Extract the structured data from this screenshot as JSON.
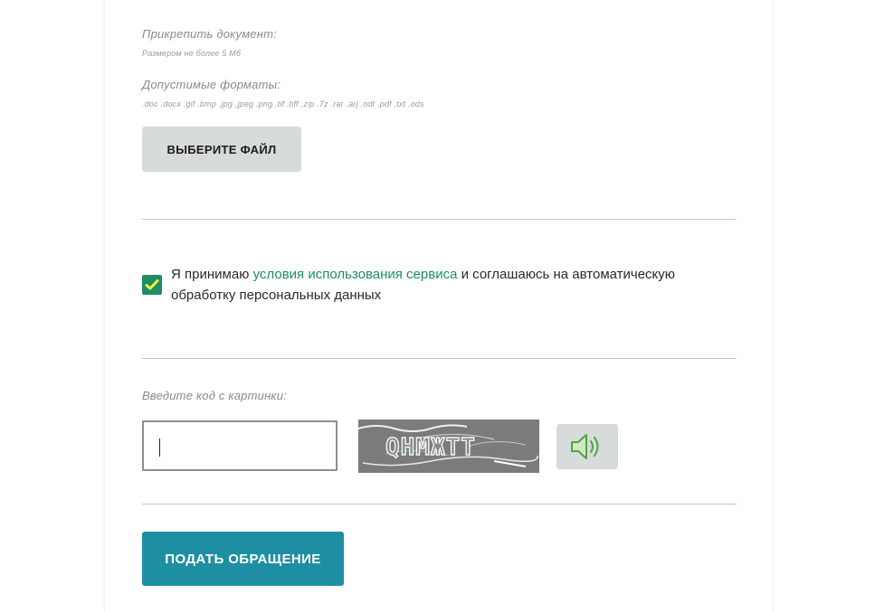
{
  "attach": {
    "label": "Прикрепить документ:",
    "size_hint": "Размером не более 5 Мб",
    "formats_label": "Допустимые форматы:",
    "formats_list": ".doc .docx .gif .bmp .jpg .jpeg .png .tif .tiff .zip .7z .rar .arj .odt .pdf .txt .ods",
    "choose_file_label": "ВЫБЕРИТЕ ФАЙЛ"
  },
  "consent": {
    "checked": true,
    "text_before": "Я принимаю ",
    "link_text": "условия использования сервиса",
    "text_after": " и соглашаюсь на автоматическую обработку персональных данных"
  },
  "captcha": {
    "label": "Введите код с картинки:",
    "input_value": "",
    "image_text": "QHMЖTT"
  },
  "submit": {
    "label": "ПОДАТЬ ОБРАЩЕНИЕ"
  },
  "colors": {
    "accent_green": "#1f8c63",
    "submit_teal": "#1e8fa3",
    "button_gray": "#d7dbdb",
    "speaker_green": "#4fa43f"
  }
}
